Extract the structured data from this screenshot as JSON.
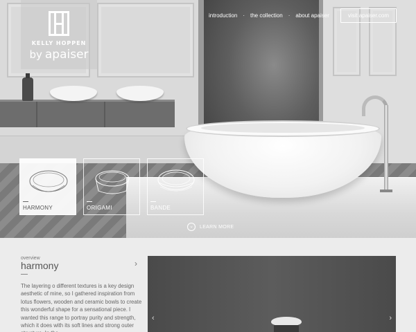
{
  "brand": {
    "name": "KELLY HOPPEN",
    "mark": "K",
    "by": "by",
    "partner": "apaiser"
  },
  "nav": {
    "links": [
      "introduction",
      "the collection",
      "about apaiser"
    ],
    "separator": "·",
    "cta": "visit apaiser.com"
  },
  "collection": [
    {
      "label": "HARMONY",
      "icon": "harmony-bath-icon",
      "active": true
    },
    {
      "label": "ORIGAMI",
      "icon": "origami-bath-icon",
      "active": false
    },
    {
      "label": "BANDE",
      "icon": "bande-bath-icon",
      "active": false
    }
  ],
  "learn_more": {
    "label": "LEARN MORE",
    "icon": "chevron-down-icon"
  },
  "overview": {
    "eyebrow": "overview",
    "title": "harmony",
    "next_icon": "chevron-right-icon",
    "body": "The layering o different textures is a key design aesthetic of mine, so I gathered inspiration from lotus flowers, wooden and ceramic bowls to create this wonderful shape for a sensational piece.  I wanted this range to portray purity and strength, which it does with its soft lines and strong outer structure.  In the"
  },
  "gallery": {
    "prev_icon": "chevron-left-icon",
    "next_icon": "chevron-right-icon",
    "prev": "‹",
    "next": "›"
  },
  "colors": {
    "accent": "#ffffff",
    "text": "#555555",
    "background": "#ececec"
  }
}
